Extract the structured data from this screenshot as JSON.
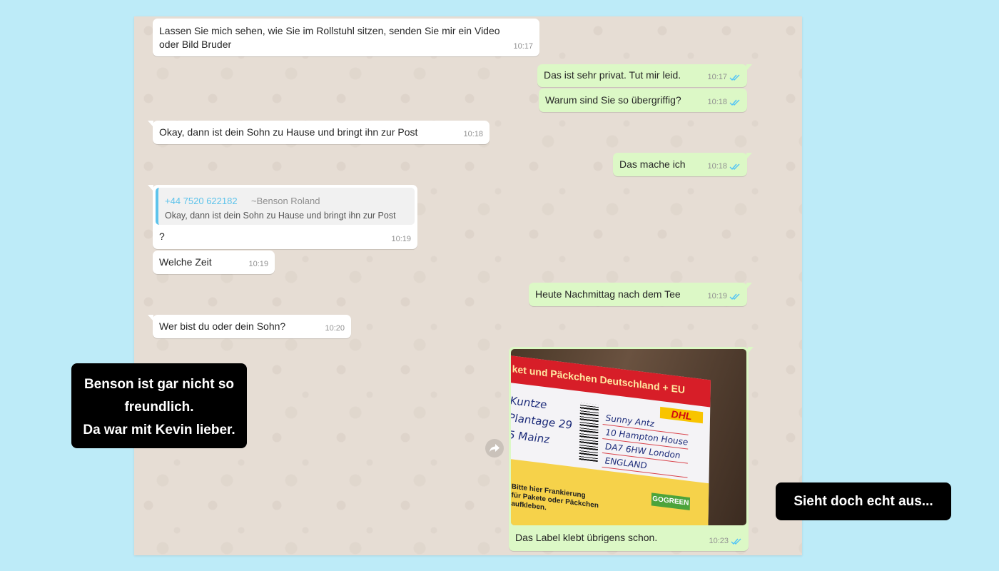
{
  "messages": [
    {
      "text": "Lassen Sie mich sehen, wie Sie im Rollstuhl sitzen, senden Sie mir ein Video\noder Bild Bruder",
      "time": "10:17"
    },
    {
      "text": "Das ist sehr privat. Tut mir leid.",
      "time": "10:17"
    },
    {
      "text": "Warum sind Sie so übergriffig?",
      "time": "10:18"
    },
    {
      "text": "Okay, dann ist dein Sohn zu Hause und bringt ihn zur Post",
      "time": "10:18"
    },
    {
      "text": "Das mache ich",
      "time": "10:18"
    },
    {
      "text": "?",
      "time": "10:19",
      "quote": {
        "number": "+44 7520 622182",
        "name": "~Benson Roland",
        "text": "Okay, dann ist dein Sohn zu Hause und bringt ihn zur Post"
      }
    },
    {
      "text": "Welche Zeit",
      "time": "10:19"
    },
    {
      "text": "Heute Nachmittag nach dem Tee",
      "time": "10:19"
    },
    {
      "text": "Wer bist du oder dein Sohn?",
      "time": "10:20"
    },
    {
      "text": "Das Label klebt übrigens schon.",
      "time": "10:23"
    }
  ],
  "photo": {
    "header": "ket und Päckchen Deutschland + EU",
    "brand": "DHL",
    "sender_lines": [
      "Kuntze",
      "Plantage 29",
      "5 Mainz"
    ],
    "recipient_lines": [
      "Sunny Antz",
      "10 Hampton House",
      "DA7 6HW London",
      "ENGLAND"
    ],
    "gogreen": "GOGREEN",
    "stamp_note": "Bitte hier Frankierung\nfür Pakete oder Päckchen\naufkleben."
  },
  "overlays": {
    "left": [
      "Benson ist gar nicht so",
      "freundlich.",
      "Da war mit Kevin lieber."
    ],
    "right": "Sieht doch echt aus..."
  },
  "colors": {
    "incoming": "#ffffff",
    "outgoing": "#dcf8c6",
    "read_ticks": "#4fc3f7",
    "background": "#bdebf8"
  },
  "icons": {
    "read": "double-check-icon",
    "forward": "forward-icon"
  }
}
